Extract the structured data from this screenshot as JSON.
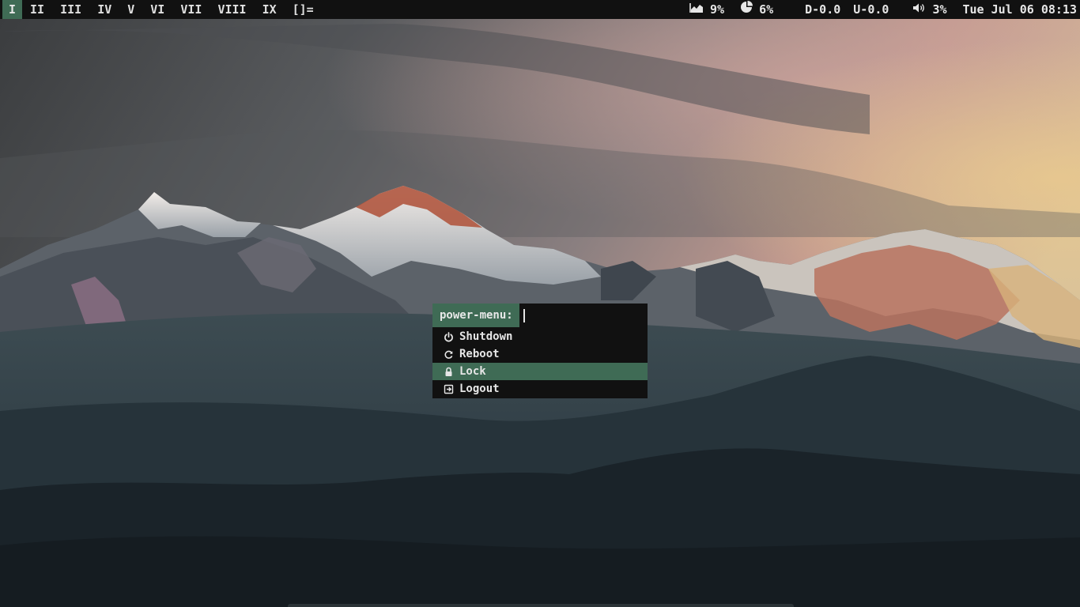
{
  "colors": {
    "bar_bg": "#111111",
    "accent": "#3f6b55",
    "text": "#e6e6e6"
  },
  "tags": [
    {
      "label": "I",
      "active": true
    },
    {
      "label": "II"
    },
    {
      "label": "III"
    },
    {
      "label": "IV"
    },
    {
      "label": "V"
    },
    {
      "label": "VI"
    },
    {
      "label": "VII"
    },
    {
      "label": "VIII"
    },
    {
      "label": "IX"
    }
  ],
  "layout_symbol": "[]=",
  "status": {
    "cpu": {
      "icon": "area-chart-icon",
      "value": "9%"
    },
    "memory": {
      "icon": "pie-chart-icon",
      "value": "6%"
    },
    "net_down": "D-0.0",
    "net_up": "U-0.0",
    "volume": {
      "icon": "volume-icon",
      "value": "3%"
    },
    "datetime": "Tue Jul 06 08:13"
  },
  "menu": {
    "prompt": "power-menu:",
    "input_value": "",
    "items": [
      {
        "label": "Shutdown",
        "icon": "power-icon"
      },
      {
        "label": "Reboot",
        "icon": "reboot-icon"
      },
      {
        "label": "Lock",
        "icon": "lock-icon",
        "selected": true
      },
      {
        "label": "Logout",
        "icon": "logout-icon"
      }
    ]
  }
}
